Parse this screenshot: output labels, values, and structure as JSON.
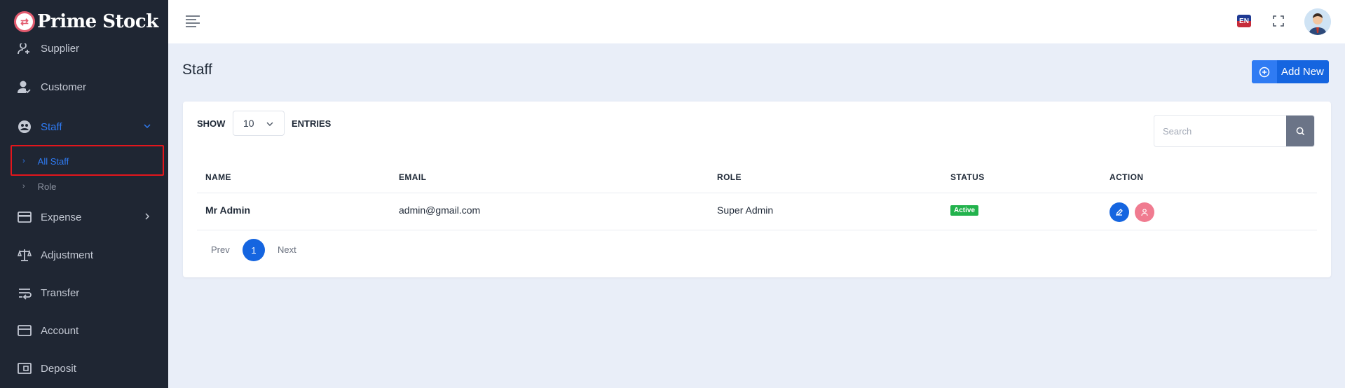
{
  "brand": {
    "logo_glyph": "⇄",
    "name": "Prime Stock",
    "logo_color": "#e25b6f"
  },
  "sidebar": {
    "items": [
      {
        "label": "Supplier",
        "icon": "user-plus-icon"
      },
      {
        "label": "Customer",
        "icon": "user-check-icon"
      },
      {
        "label": "Staff",
        "icon": "staff-icon",
        "expanded": true
      },
      {
        "label": "Expense",
        "icon": "wallet-icon"
      },
      {
        "label": "Adjustment",
        "icon": "scale-icon"
      },
      {
        "label": "Transfer",
        "icon": "transfer-icon"
      },
      {
        "label": "Account",
        "icon": "account-icon"
      },
      {
        "label": "Deposit",
        "icon": "deposit-icon"
      }
    ],
    "staff_subitems": [
      {
        "label": "All Staff",
        "active": true
      },
      {
        "label": "Role",
        "active": false
      }
    ]
  },
  "topbar": {
    "language": "EN"
  },
  "page": {
    "title": "Staff",
    "add_button": "Add New"
  },
  "table_controls": {
    "show_label": "SHOW",
    "entries_value": "10",
    "entries_label": "ENTRIES",
    "search_placeholder": "Search"
  },
  "table": {
    "headers": [
      "NAME",
      "EMAIL",
      "ROLE",
      "STATUS",
      "ACTION"
    ],
    "rows": [
      {
        "name": "Mr Admin",
        "email": "admin@gmail.com",
        "role": "Super Admin",
        "status": "Active"
      }
    ]
  },
  "pagination": {
    "prev": "Prev",
    "current": "1",
    "next": "Next"
  },
  "colors": {
    "accent": "#1565e0",
    "sidebar_bg": "#1f2633",
    "status_active": "#22b24c",
    "highlight": "#e3161c"
  }
}
